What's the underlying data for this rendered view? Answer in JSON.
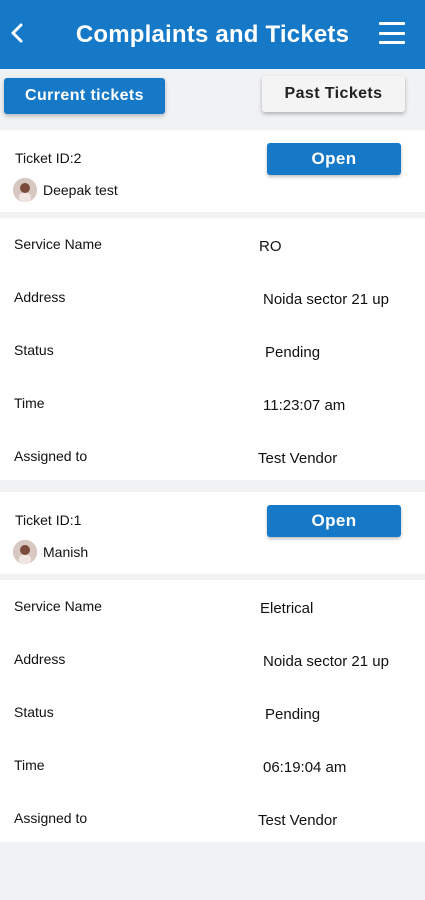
{
  "header": {
    "title": "Complaints and Tickets"
  },
  "tabs": {
    "current": "Current tickets",
    "past": "Past Tickets"
  },
  "tickets": [
    {
      "ticket_id": "Ticket ID:2",
      "user": "Deepak test",
      "action": "Open",
      "details": [
        {
          "label": "Service Name",
          "value": "RO"
        },
        {
          "label": "Address",
          "value": "Noida sector 21 up"
        },
        {
          "label": "Status",
          "value": "Pending"
        },
        {
          "label": "Time",
          "value": "11:23:07 am"
        },
        {
          "label": "Assigned to",
          "value": "Test Vendor"
        }
      ]
    },
    {
      "ticket_id": "Ticket ID:1",
      "user": "Manish",
      "action": "Open",
      "details": [
        {
          "label": "Service Name",
          "value": "Eletrical"
        },
        {
          "label": "Address",
          "value": "Noida sector 21 up"
        },
        {
          "label": "Status",
          "value": "Pending"
        },
        {
          "label": "Time",
          "value": "06:19:04 am"
        },
        {
          "label": "Assigned to",
          "value": "Test Vendor"
        }
      ]
    }
  ]
}
